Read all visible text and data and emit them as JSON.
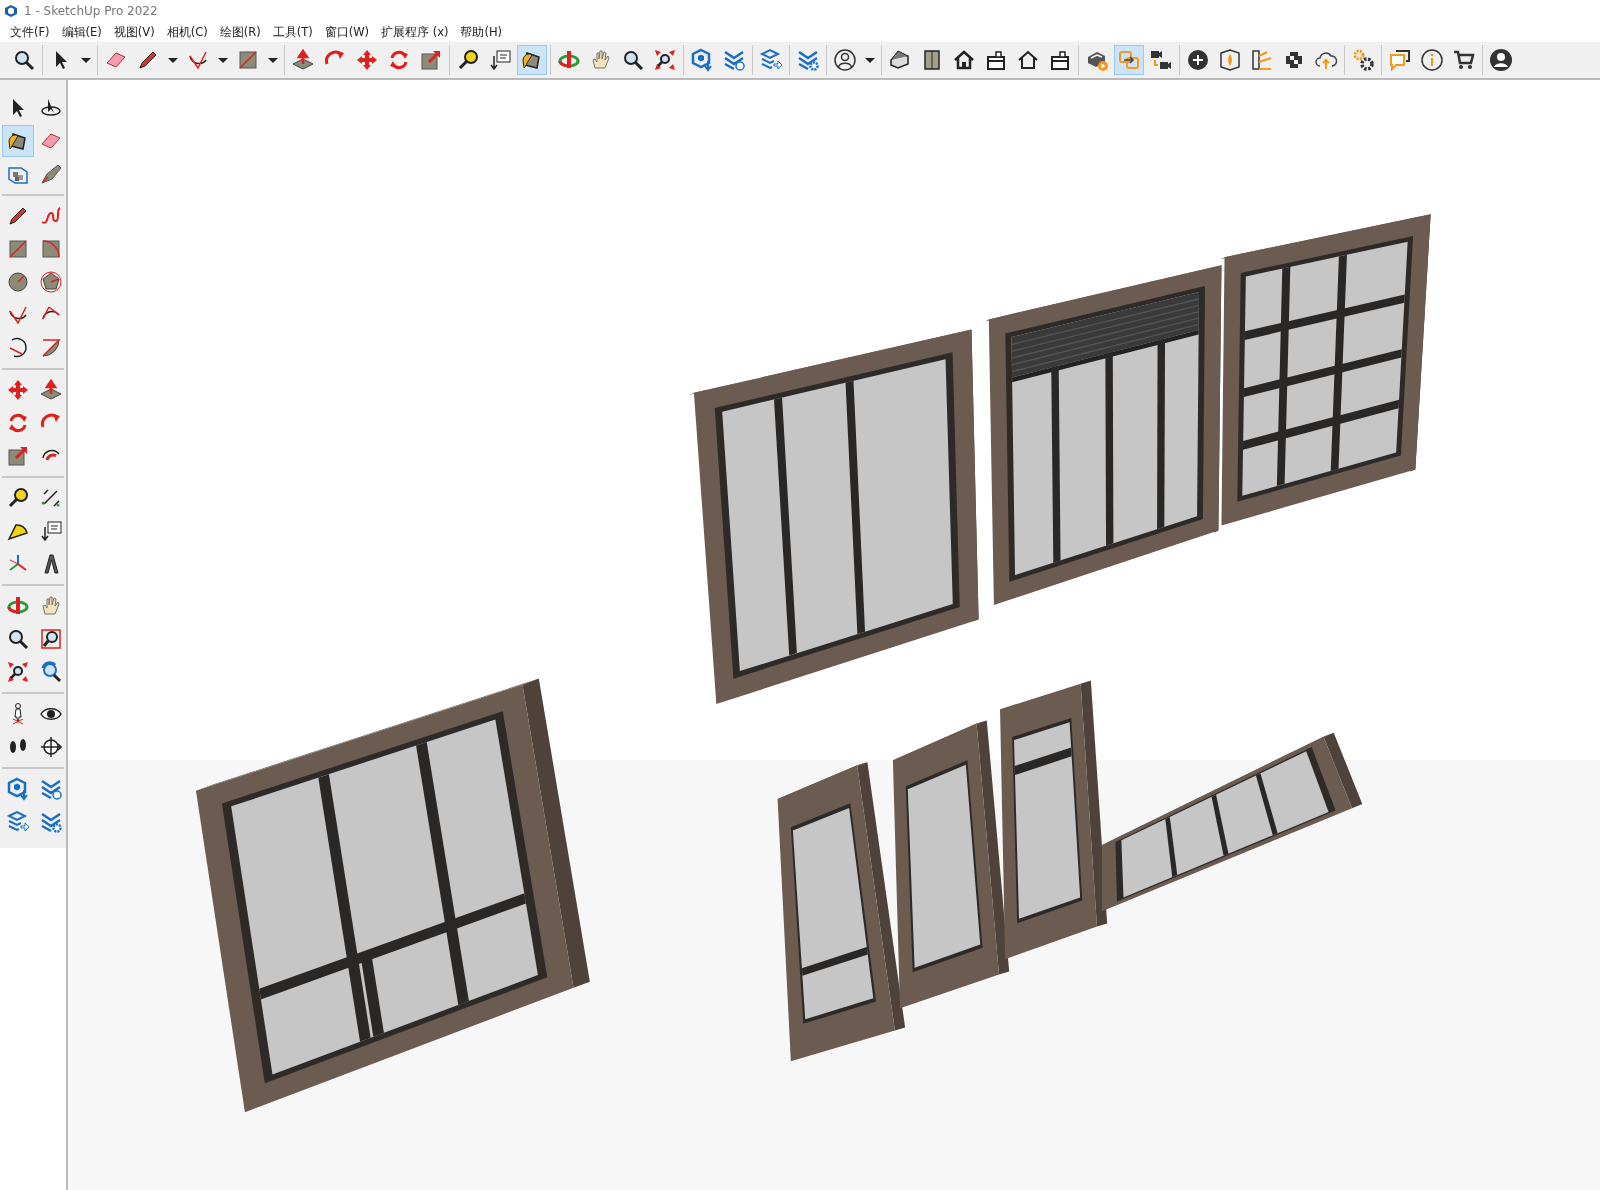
{
  "window": {
    "title": "1 - SketchUp Pro 2022"
  },
  "menu": [
    "文件(F)",
    "编辑(E)",
    "视图(V)",
    "相机(C)",
    "绘图(R)",
    "工具(T)",
    "窗口(W)",
    "扩展程序 (x)",
    "帮助(H)"
  ],
  "toolbar": {
    "groups": [
      {
        "items": [
          {
            "kind": "zoom",
            "selected": false
          }
        ]
      },
      {
        "items": [
          {
            "kind": "select",
            "selected": false
          },
          {
            "kind": "caret",
            "selected": false
          }
        ]
      },
      {
        "items": [
          {
            "kind": "eraser",
            "selected": false
          },
          {
            "kind": "pencil",
            "selected": false
          },
          {
            "kind": "caret",
            "selected": false
          },
          {
            "kind": "arc",
            "selected": false
          },
          {
            "kind": "caret",
            "selected": false
          },
          {
            "kind": "rect",
            "selected": false
          },
          {
            "kind": "caret",
            "selected": false
          }
        ]
      },
      {
        "items": [
          {
            "kind": "pushpull",
            "selected": false
          },
          {
            "kind": "followme",
            "selected": false
          },
          {
            "kind": "move",
            "selected": false
          },
          {
            "kind": "rotate",
            "selected": false
          },
          {
            "kind": "scale",
            "selected": false
          }
        ]
      },
      {
        "items": [
          {
            "kind": "tape",
            "selected": false
          },
          {
            "kind": "label",
            "selected": false
          },
          {
            "kind": "paint",
            "selected": true
          }
        ]
      },
      {
        "items": [
          {
            "kind": "orbit",
            "selected": false
          },
          {
            "kind": "pan",
            "selected": false
          },
          {
            "kind": "zoom",
            "selected": false
          },
          {
            "kind": "extents",
            "selected": false
          }
        ]
      },
      {
        "items": [
          {
            "kind": "warehouse",
            "selected": false
          },
          {
            "kind": "extension",
            "selected": false
          }
        ]
      },
      {
        "items": [
          {
            "kind": "layers",
            "selected": false
          }
        ]
      },
      {
        "items": [
          {
            "kind": "extsettings",
            "selected": false
          }
        ]
      },
      {
        "items": [
          {
            "kind": "user",
            "selected": false
          },
          {
            "kind": "caret",
            "selected": false
          }
        ]
      },
      {
        "items": [
          {
            "kind": "iso",
            "selected": false
          },
          {
            "kind": "front",
            "selected": false
          },
          {
            "kind": "house",
            "selected": false
          },
          {
            "kind": "box",
            "selected": false
          },
          {
            "kind": "houseline",
            "selected": false
          },
          {
            "kind": "box",
            "selected": false
          }
        ]
      },
      {
        "items": [
          {
            "kind": "solid",
            "selected": false
          },
          {
            "kind": "swap",
            "selected": true
          },
          {
            "kind": "camera",
            "selected": false
          }
        ]
      },
      {
        "items": [
          {
            "kind": "plus",
            "selected": false
          },
          {
            "kind": "section",
            "selected": false
          },
          {
            "kind": "styles",
            "selected": false
          },
          {
            "kind": "checker",
            "selected": false
          },
          {
            "kind": "cloud",
            "selected": false
          }
        ]
      },
      {
        "items": [
          {
            "kind": "gears",
            "selected": false
          }
        ]
      },
      {
        "items": [
          {
            "kind": "chat",
            "selected": false
          },
          {
            "kind": "info",
            "selected": false
          },
          {
            "kind": "cart",
            "selected": false
          }
        ]
      },
      {
        "items": [
          {
            "kind": "avatar",
            "selected": false
          }
        ]
      }
    ]
  },
  "side_toolbar": {
    "groups": [
      {
        "items": [
          {
            "kind": "select",
            "selected": false
          },
          {
            "kind": "orbitsel",
            "selected": false
          },
          {
            "kind": "paint",
            "selected": true
          },
          {
            "kind": "eraser",
            "selected": false
          },
          {
            "kind": "component",
            "selected": false
          },
          {
            "kind": "tag",
            "selected": false
          }
        ]
      },
      {
        "items": [
          {
            "kind": "pencil",
            "selected": false
          },
          {
            "kind": "freehand",
            "selected": false
          },
          {
            "kind": "rect",
            "selected": false
          },
          {
            "kind": "rotrect",
            "selected": false
          },
          {
            "kind": "circle",
            "selected": false
          },
          {
            "kind": "polygon",
            "selected": false
          },
          {
            "kind": "arc",
            "selected": false
          },
          {
            "kind": "arc3",
            "selected": false
          },
          {
            "kind": "arc2",
            "selected": false
          },
          {
            "kind": "pie",
            "selected": false
          }
        ]
      },
      {
        "items": [
          {
            "kind": "move",
            "selected": false
          },
          {
            "kind": "pushpull",
            "selected": false
          },
          {
            "kind": "rotate",
            "selected": false
          },
          {
            "kind": "followme",
            "selected": false
          },
          {
            "kind": "scale",
            "selected": false
          },
          {
            "kind": "offset",
            "selected": false
          }
        ]
      },
      {
        "items": [
          {
            "kind": "tape",
            "selected": false
          },
          {
            "kind": "dimension",
            "selected": false
          },
          {
            "kind": "protractor",
            "selected": false
          },
          {
            "kind": "label",
            "selected": false
          },
          {
            "kind": "axes",
            "selected": false
          },
          {
            "kind": "text3d",
            "selected": false
          }
        ]
      },
      {
        "items": [
          {
            "kind": "orbit",
            "selected": false
          },
          {
            "kind": "pan",
            "selected": false
          },
          {
            "kind": "zoom",
            "selected": false
          },
          {
            "kind": "zoomwin",
            "selected": false
          },
          {
            "kind": "extents",
            "selected": false
          },
          {
            "kind": "previous",
            "selected": false
          }
        ]
      },
      {
        "items": [
          {
            "kind": "walk",
            "selected": false
          },
          {
            "kind": "eye",
            "selected": false
          },
          {
            "kind": "footprints",
            "selected": false
          },
          {
            "kind": "position",
            "selected": false
          }
        ]
      },
      {
        "items": [
          {
            "kind": "warehouse",
            "selected": false
          },
          {
            "kind": "extension",
            "selected": false
          },
          {
            "kind": "layers",
            "selected": false
          },
          {
            "kind": "extsettings",
            "selected": false
          }
        ]
      }
    ]
  }
}
